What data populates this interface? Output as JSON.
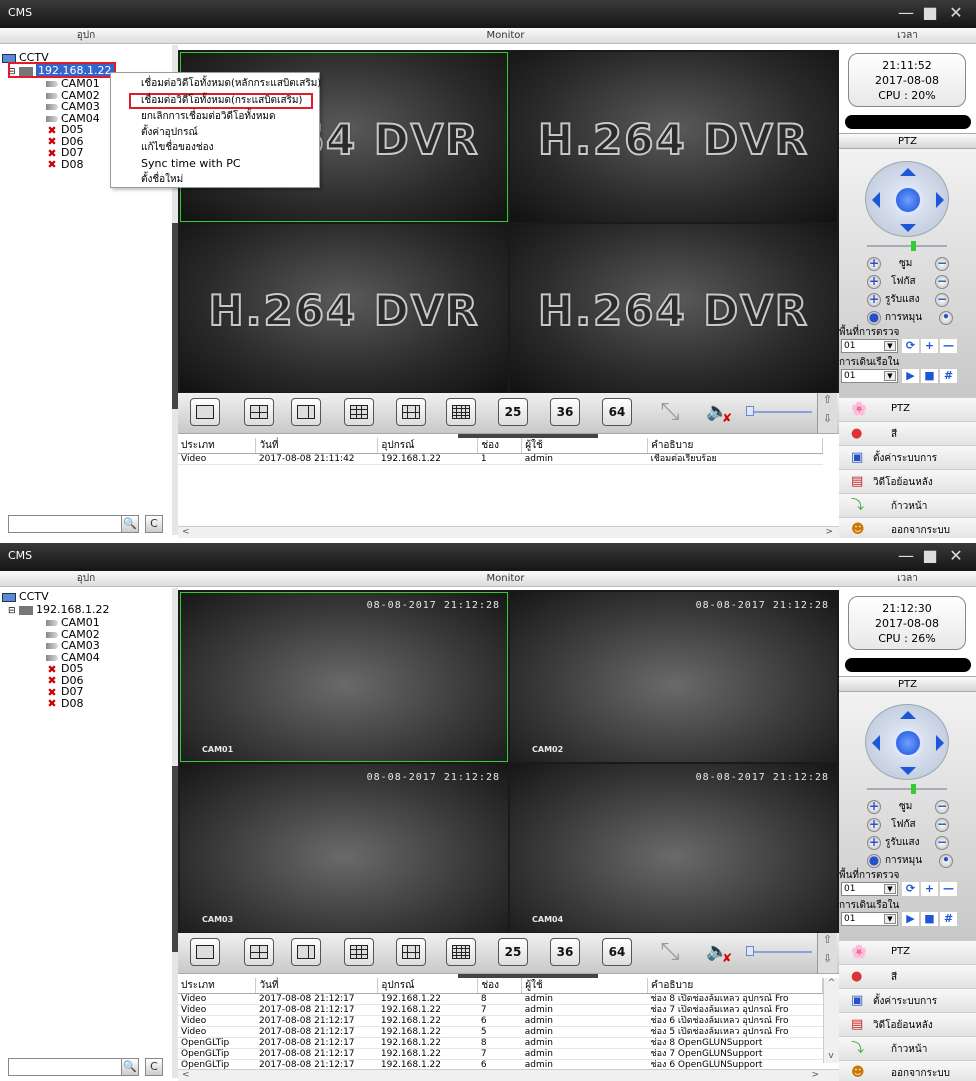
{
  "app_title": "CMS",
  "headers": {
    "device": "อุปก",
    "monitor": "Monitor",
    "time": "เวลา"
  },
  "windows": [
    {
      "clock": {
        "time": "21:11:52",
        "date": "2017-08-08",
        "cpu": "CPU : 20%"
      },
      "tree": {
        "root": "CCTV",
        "ip": "192.168.1.22",
        "channels": [
          "CAM01",
          "CAM02",
          "CAM03",
          "CAM04",
          "D05",
          "D06",
          "D07",
          "D08"
        ]
      },
      "tiles": [
        "H.264 DVR",
        "H.264 DVR",
        "H.264 DVR",
        "H.264 DVR"
      ],
      "context_menu": [
        "เชื่อมต่อวิดีโอทั้งหมด(หลักกระแสบิตเสริม)",
        "เชื่อมต่อวิดีโอทั้งหมด(กระแสบิตเสริม)",
        "ยกเลิกการเชื่อมต่อวิดีโอทั้งหมด",
        "ตั้งค่าอุปกรณ์",
        "แก้ไขชื่อของช่อง",
        "Sync time with PC",
        "ตั้งชื่อใหม่"
      ],
      "log_headers": [
        "ประเภท",
        "วันที่",
        "อุปกรณ์",
        "ช่อง",
        "ผู้ใช้",
        "คำอธิบาย"
      ],
      "log_rows": [
        [
          "Video",
          "2017-08-08 21:11:42",
          "192.168.1.22",
          "1",
          "admin",
          "เชื่อมต่อเรียบร้อย"
        ]
      ]
    },
    {
      "clock": {
        "time": "21:12:30",
        "date": "2017-08-08",
        "cpu": "CPU : 26%"
      },
      "tree": {
        "root": "CCTV",
        "ip": "192.168.1.22",
        "channels": [
          "CAM01",
          "CAM02",
          "CAM03",
          "CAM04",
          "D05",
          "D06",
          "D07",
          "D08"
        ]
      },
      "tiles": [
        {
          "ts": "08-08-2017 21:12:28",
          "name": "CAM01"
        },
        {
          "ts": "08-08-2017 21:12:28",
          "name": "CAM02"
        },
        {
          "ts": "08-08-2017 21:12:28",
          "name": "CAM03"
        },
        {
          "ts": "08-08-2017 21:12:28",
          "name": "CAM04"
        }
      ],
      "log_headers": [
        "ประเภท",
        "วันที่",
        "อุปกรณ์",
        "ช่อง",
        "ผู้ใช้",
        "คำอธิบาย"
      ],
      "log_rows": [
        [
          "Video",
          "2017-08-08 21:12:17",
          "192.168.1.22",
          "8",
          "admin",
          "ช่อง 8 เปิดช่องล้มเหลว อุปกรณ์ Fro"
        ],
        [
          "Video",
          "2017-08-08 21:12:17",
          "192.168.1.22",
          "7",
          "admin",
          "ช่อง 7 เปิดช่องล้มเหลว อุปกรณ์ Fro"
        ],
        [
          "Video",
          "2017-08-08 21:12:17",
          "192.168.1.22",
          "6",
          "admin",
          "ช่อง 6 เปิดช่องล้มเหลว อุปกรณ์ Fro"
        ],
        [
          "Video",
          "2017-08-08 21:12:17",
          "192.168.1.22",
          "5",
          "admin",
          "ช่อง 5 เปิดช่องล้มเหลว อุปกรณ์ Fro"
        ],
        [
          "OpenGLTip",
          "2017-08-08 21:12:17",
          "192.168.1.22",
          "8",
          "admin",
          "ช่อง 8 OpenGLUNSupport"
        ],
        [
          "OpenGLTip",
          "2017-08-08 21:12:17",
          "192.168.1.22",
          "7",
          "admin",
          "ช่อง 7 OpenGLUNSupport"
        ],
        [
          "OpenGLTip",
          "2017-08-08 21:12:17",
          "192.168.1.22",
          "6",
          "admin",
          "ช่อง 6 OpenGLUNSupport"
        ]
      ]
    }
  ],
  "toolbar": {
    "n25": "25",
    "n36": "36",
    "n64": "64"
  },
  "ptz": {
    "header": "PTZ",
    "zoom": "ซูม",
    "focus": "โฟกัส",
    "iris": "รูรับแสง",
    "rotate": "การหมุน",
    "area_label": "พื้นที่การตรวจ",
    "cruise_label": "การเดินเรือใน",
    "preset_value": "01",
    "cruise_value": "01"
  },
  "menu": {
    "ptz": "PTZ",
    "color": "สี",
    "system": "ตั้งค่าระบบการ",
    "playback": "วิดีโอย้อนหลัง",
    "forward": "ก้าวหน้า",
    "logout": "ออกจากระบบ"
  },
  "colors": {
    "accent": "#e01c2a",
    "selection": "#3366cc",
    "tile_border": "#33cc33"
  }
}
